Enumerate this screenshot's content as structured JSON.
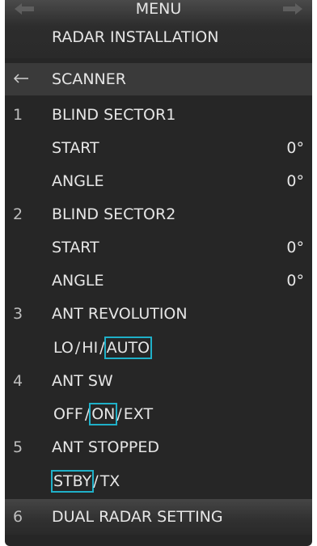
{
  "header": {
    "menu_label": "MENU",
    "subtitle": "RADAR INSTALLATION",
    "left_arrow_icon": "arrow-left-icon",
    "right_arrow_icon": "arrow-right-icon"
  },
  "scanner": {
    "label": "SCANNER",
    "back_icon": "back-arrow-icon"
  },
  "items": {
    "blind1": {
      "num": "1",
      "label": "BLIND SECTOR1",
      "start_label": "START",
      "start_value": "0°",
      "angle_label": "ANGLE",
      "angle_value": "0°"
    },
    "blind2": {
      "num": "2",
      "label": "BLIND SECTOR2",
      "start_label": "START",
      "start_value": "0°",
      "angle_label": "ANGLE",
      "angle_value": "0°"
    },
    "ant_rev": {
      "num": "3",
      "label": "ANT REVOLUTION",
      "options": [
        "LO",
        "HI",
        "AUTO"
      ],
      "selected": "AUTO"
    },
    "ant_sw": {
      "num": "4",
      "label": "ANT SW",
      "options": [
        "OFF",
        "ON",
        "EXT"
      ],
      "selected": "ON"
    },
    "ant_stopped": {
      "num": "5",
      "label": "ANT STOPPED",
      "options": [
        "STBY",
        "TX"
      ],
      "selected": "STBY"
    },
    "dual": {
      "num": "6",
      "label": "DUAL RADAR SETTING"
    }
  },
  "colors": {
    "panel": "#262626",
    "text": "#e6e6e6",
    "selection": "#1fb0c8"
  }
}
